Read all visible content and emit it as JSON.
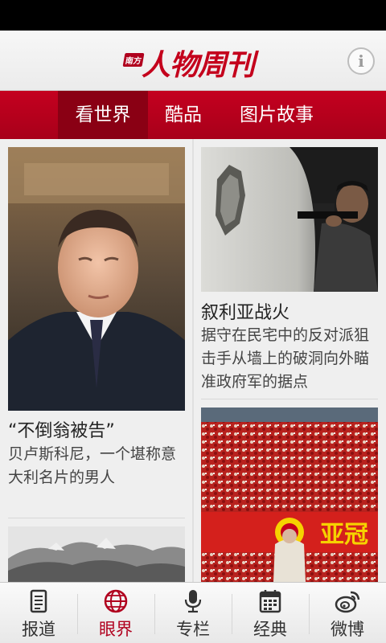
{
  "header": {
    "logo_tag": "南方",
    "logo_text": "人物周刊",
    "info_icon": "info-icon",
    "info_glyph": "i"
  },
  "tabs": [
    {
      "label": "看世界",
      "active": true
    },
    {
      "label": "酷品",
      "active": false
    },
    {
      "label": "图片故事",
      "active": false
    }
  ],
  "articles": [
    {
      "title": "“不倒翁被告”",
      "desc": "贝卢斯科尼，一个堪称意大利名片的男人",
      "image": "portrait-photo"
    },
    {
      "title": "叙利亚战火",
      "desc": "据守在民宅中的反对派狙击手从墙上的破洞向外瞄准政府军的据点",
      "image": "sniper-photo"
    },
    {
      "title": "",
      "desc": "",
      "image": "mountain-photo"
    },
    {
      "title": "",
      "desc": "",
      "image": "stadium-photo",
      "banner_text": "亚冠"
    }
  ],
  "bottom_nav": [
    {
      "label": "报道",
      "icon": "document-icon",
      "active": false
    },
    {
      "label": "眼界",
      "icon": "globe-icon",
      "active": true
    },
    {
      "label": "专栏",
      "icon": "microphone-icon",
      "active": false
    },
    {
      "label": "经典",
      "icon": "calendar-icon",
      "active": false
    },
    {
      "label": "微博",
      "icon": "weibo-icon",
      "active": false
    }
  ],
  "colors": {
    "brand_red": "#c4001c",
    "active_tab": "#8a0014"
  }
}
